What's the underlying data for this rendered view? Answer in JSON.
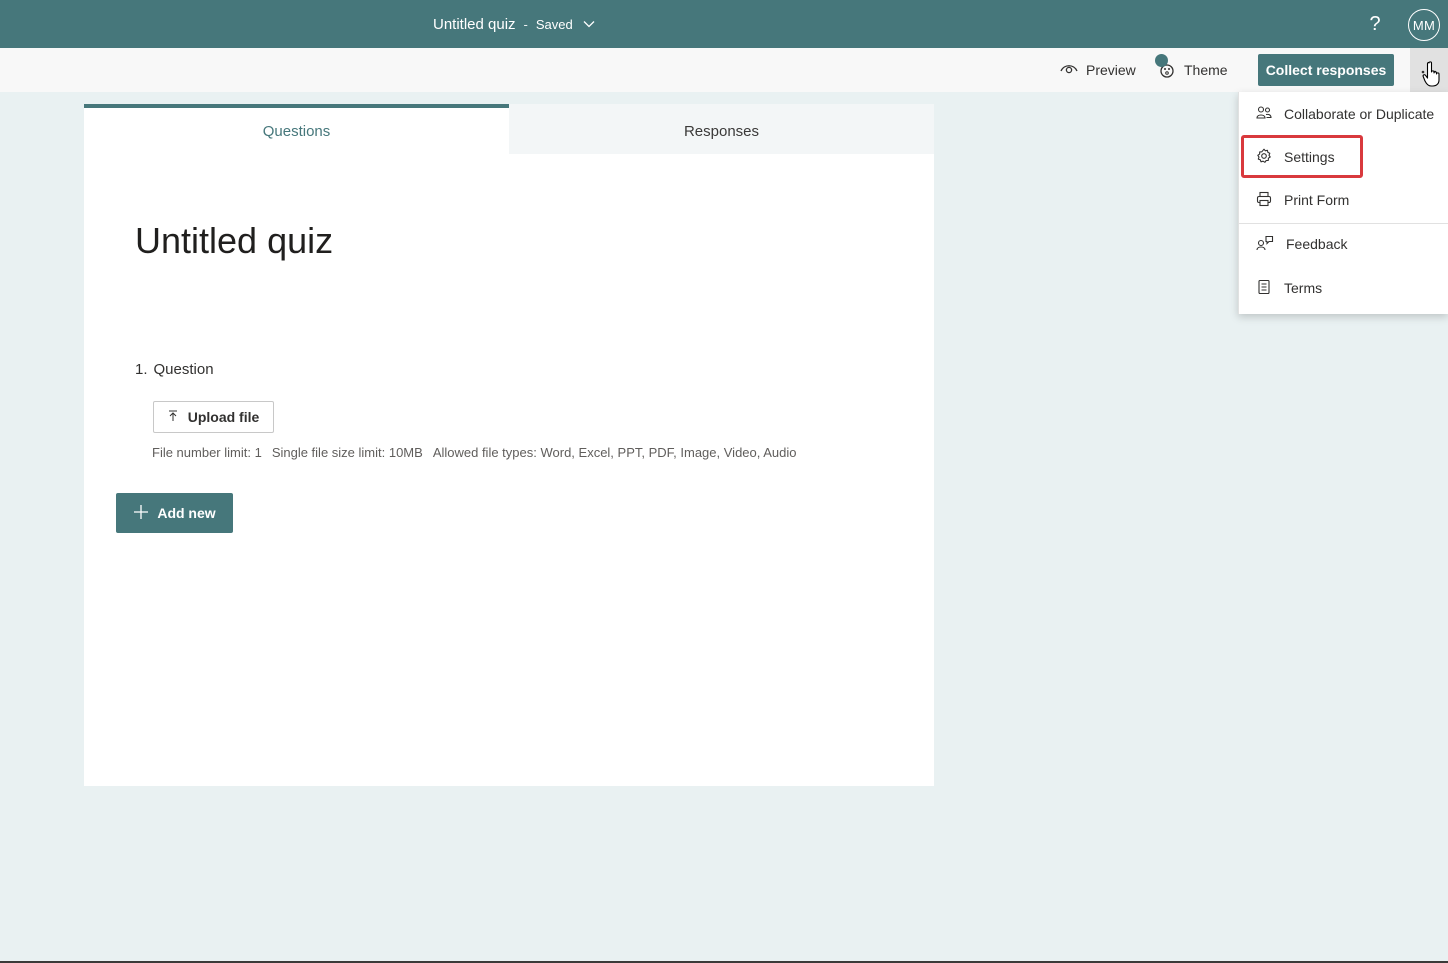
{
  "header": {
    "title": "Untitled quiz",
    "separator": "-",
    "status": "Saved",
    "help": "?",
    "avatar_initials": "MM"
  },
  "toolbar": {
    "preview_label": "Preview",
    "theme_label": "Theme",
    "theme_badge": "",
    "collect_label": "Collect responses"
  },
  "tabs": {
    "questions": "Questions",
    "responses": "Responses"
  },
  "form": {
    "title": "Untitled quiz",
    "question_number": "1.",
    "question_text": "Question",
    "upload_label": "Upload file",
    "file_number_limit": "File number limit: 1",
    "file_size_limit": "Single file size limit: 10MB",
    "file_types": "Allowed file types: Word, Excel, PPT, PDF, Image, Video, Audio",
    "add_new_label": "Add new"
  },
  "menu": {
    "items": [
      {
        "label": "Collaborate or Duplicate",
        "icon": "people-icon"
      },
      {
        "label": "Settings",
        "icon": "gear-icon"
      },
      {
        "label": "Print Form",
        "icon": "printer-icon"
      },
      {
        "label": "Feedback",
        "icon": "feedback-icon"
      },
      {
        "label": "Terms",
        "icon": "document-icon"
      }
    ]
  },
  "colors": {
    "brand": "#46777b",
    "background": "#e9f1f2",
    "highlight": "#d9393d"
  }
}
